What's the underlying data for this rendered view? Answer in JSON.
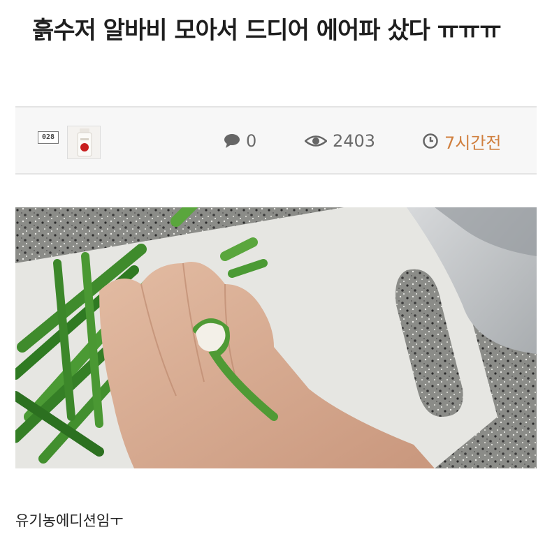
{
  "post": {
    "title": "흙수저 알바비 모아서 드디어 에어파 샀다 ㅠㅠㅠ",
    "comment_count": "0",
    "view_count": "2403",
    "time_ago": "7시간전",
    "caption": "유기농에디션임ㅜ"
  },
  "author": {
    "level_badge": "028"
  },
  "icons": {
    "comments": "speech-bubble-icon",
    "views": "eye-icon",
    "time": "clock-icon"
  },
  "colors": {
    "meta_background": "#f7f7f7",
    "time_accent": "#d07f3e",
    "stat_text": "#6a6a6a"
  }
}
